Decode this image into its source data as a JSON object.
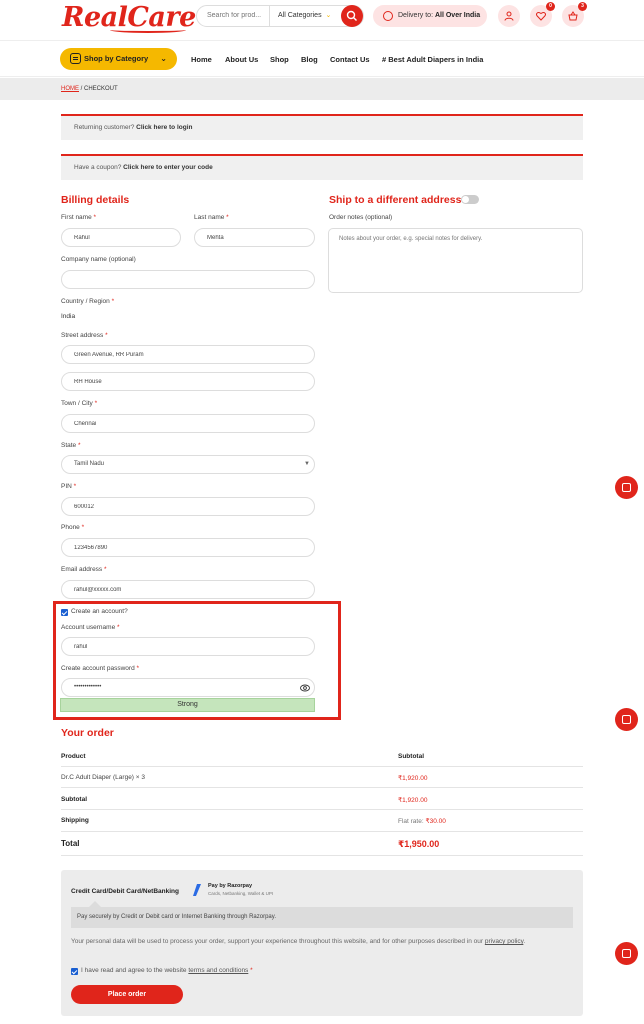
{
  "header": {
    "logo": "RealCare",
    "search_placeholder": "Search for prod...",
    "search_category": "All Categories",
    "delivery_prefix": "Delivery to: ",
    "delivery_location": "All Over India",
    "wishlist_count": "0",
    "cart_count": "3"
  },
  "nav": {
    "category_button": "Shop by Category",
    "links": [
      "Home",
      "About Us",
      "Shop",
      "Blog",
      "Contact Us",
      "# Best Adult Diapers in India"
    ]
  },
  "breadcrumb": {
    "home": "HOME",
    "current": " / CHECKOUT"
  },
  "notices": {
    "returning_prefix": "Returning customer? ",
    "returning_link": "Click here to login",
    "coupon_prefix": "Have a coupon? ",
    "coupon_link": "Click here to enter your code"
  },
  "billing": {
    "heading": "Billing details",
    "first_name_label": "First name",
    "first_name": "Rahul",
    "last_name_label": "Last name",
    "last_name": "Mehta",
    "company_label": "Company name (optional)",
    "company": "",
    "country_label": "Country / Region",
    "country": "India",
    "street_label": "Street address",
    "street1": "Green Avenue, RR Puram",
    "street2": "RH House",
    "city_label": "Town / City",
    "city": "Chennai",
    "state_label": "State",
    "state": "Tamil Nadu",
    "pin_label": "PIN",
    "pin": "600012",
    "phone_label": "Phone",
    "phone": "1234567890",
    "email_label": "Email address",
    "email": "rahul@xxxxx.com",
    "create_account": "Create an account?",
    "username_label": "Account username",
    "username": "rahul",
    "password_label": "Create account password",
    "password": "•••••••••••••",
    "strength": "Strong",
    "required_mark": "*"
  },
  "shipping": {
    "heading": "Ship to a different address?",
    "notes_label": "Order notes (optional)",
    "notes_placeholder": "Notes about your order, e.g. special notes for delivery."
  },
  "order": {
    "heading": "Your order",
    "col_product": "Product",
    "col_subtotal": "Subtotal",
    "item_name": "Dr.C Adult Diaper (Large)",
    "item_qty": "× 3",
    "item_price": "₹1,920.00",
    "subtotal_label": "Subtotal",
    "subtotal": "₹1,920.00",
    "shipping_label": "Shipping",
    "shipping_prefix": "Flat rate: ",
    "shipping_price": "₹30.00",
    "total_label": "Total",
    "total": "₹1,950.00"
  },
  "payment": {
    "method": "Credit Card/Debit Card/NetBanking",
    "rzp_main": "Pay by Razorpay",
    "rzp_sub": "Cards, Netbanking, Wallet & UPI",
    "description": "Pay securely by Credit or Debit card or Internet Banking through Razorpay.",
    "privacy_text": "Your personal data will be used to process your order, support your experience throughout this website, and for other purposes described in our ",
    "privacy_link": "privacy policy",
    "privacy_end": ".",
    "terms_prefix": "I have read and agree to the website ",
    "terms_link": "terms and conditions",
    "terms_req": "*",
    "place_order": "Place order"
  },
  "colors": {
    "brand_red": "#e0251b",
    "accent_yellow": "#f5b800",
    "strength_green": "#c5e5bc"
  }
}
